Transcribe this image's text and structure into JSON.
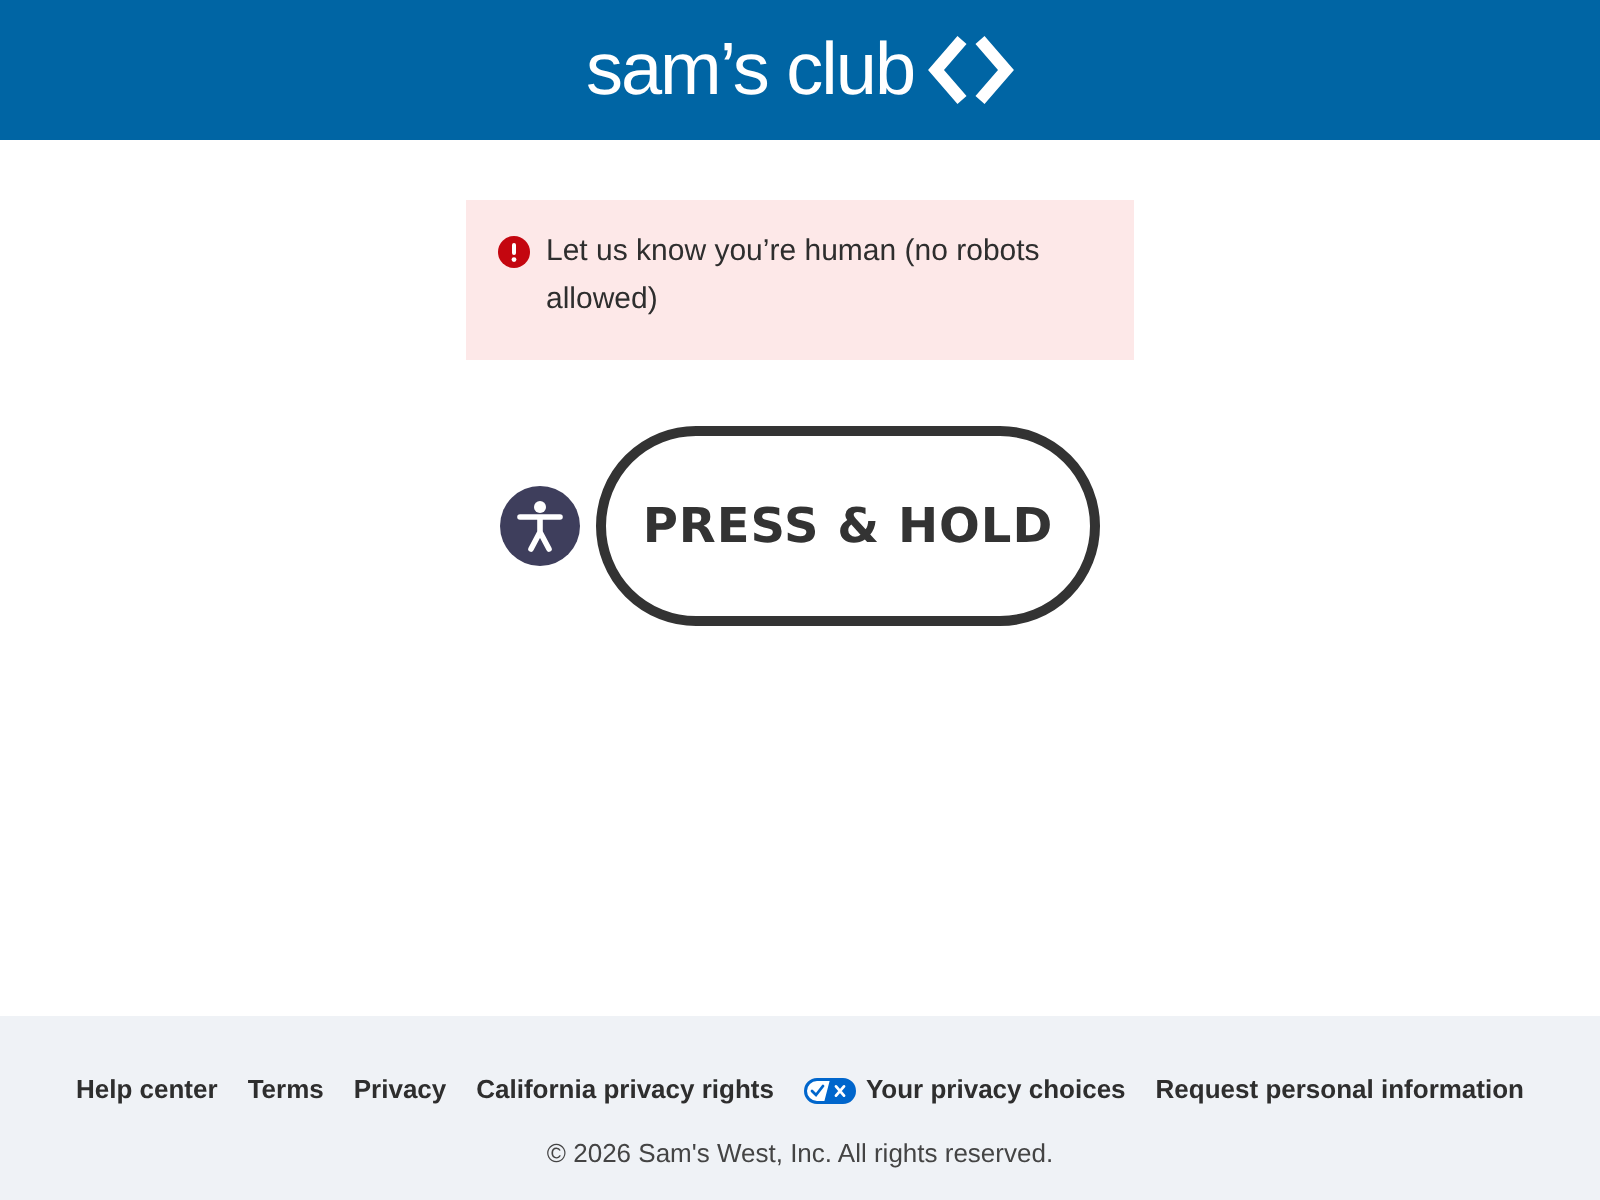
{
  "header": {
    "logo_text": "sam’s club"
  },
  "alert": {
    "kind": "error",
    "message": "Let us know you’re human (no robots allowed)"
  },
  "challenge": {
    "button_label": "PRESS & HOLD"
  },
  "footer": {
    "links": [
      {
        "label": "Help center",
        "kind": "text"
      },
      {
        "label": "Terms",
        "kind": "text"
      },
      {
        "label": "Privacy",
        "kind": "text"
      },
      {
        "label": "California privacy rights",
        "kind": "text"
      },
      {
        "label": "Your privacy choices",
        "kind": "privacy-choices"
      },
      {
        "label": "Request personal information",
        "kind": "text"
      }
    ],
    "copyright": "© 2026 Sam's West, Inc. All rights reserved."
  }
}
